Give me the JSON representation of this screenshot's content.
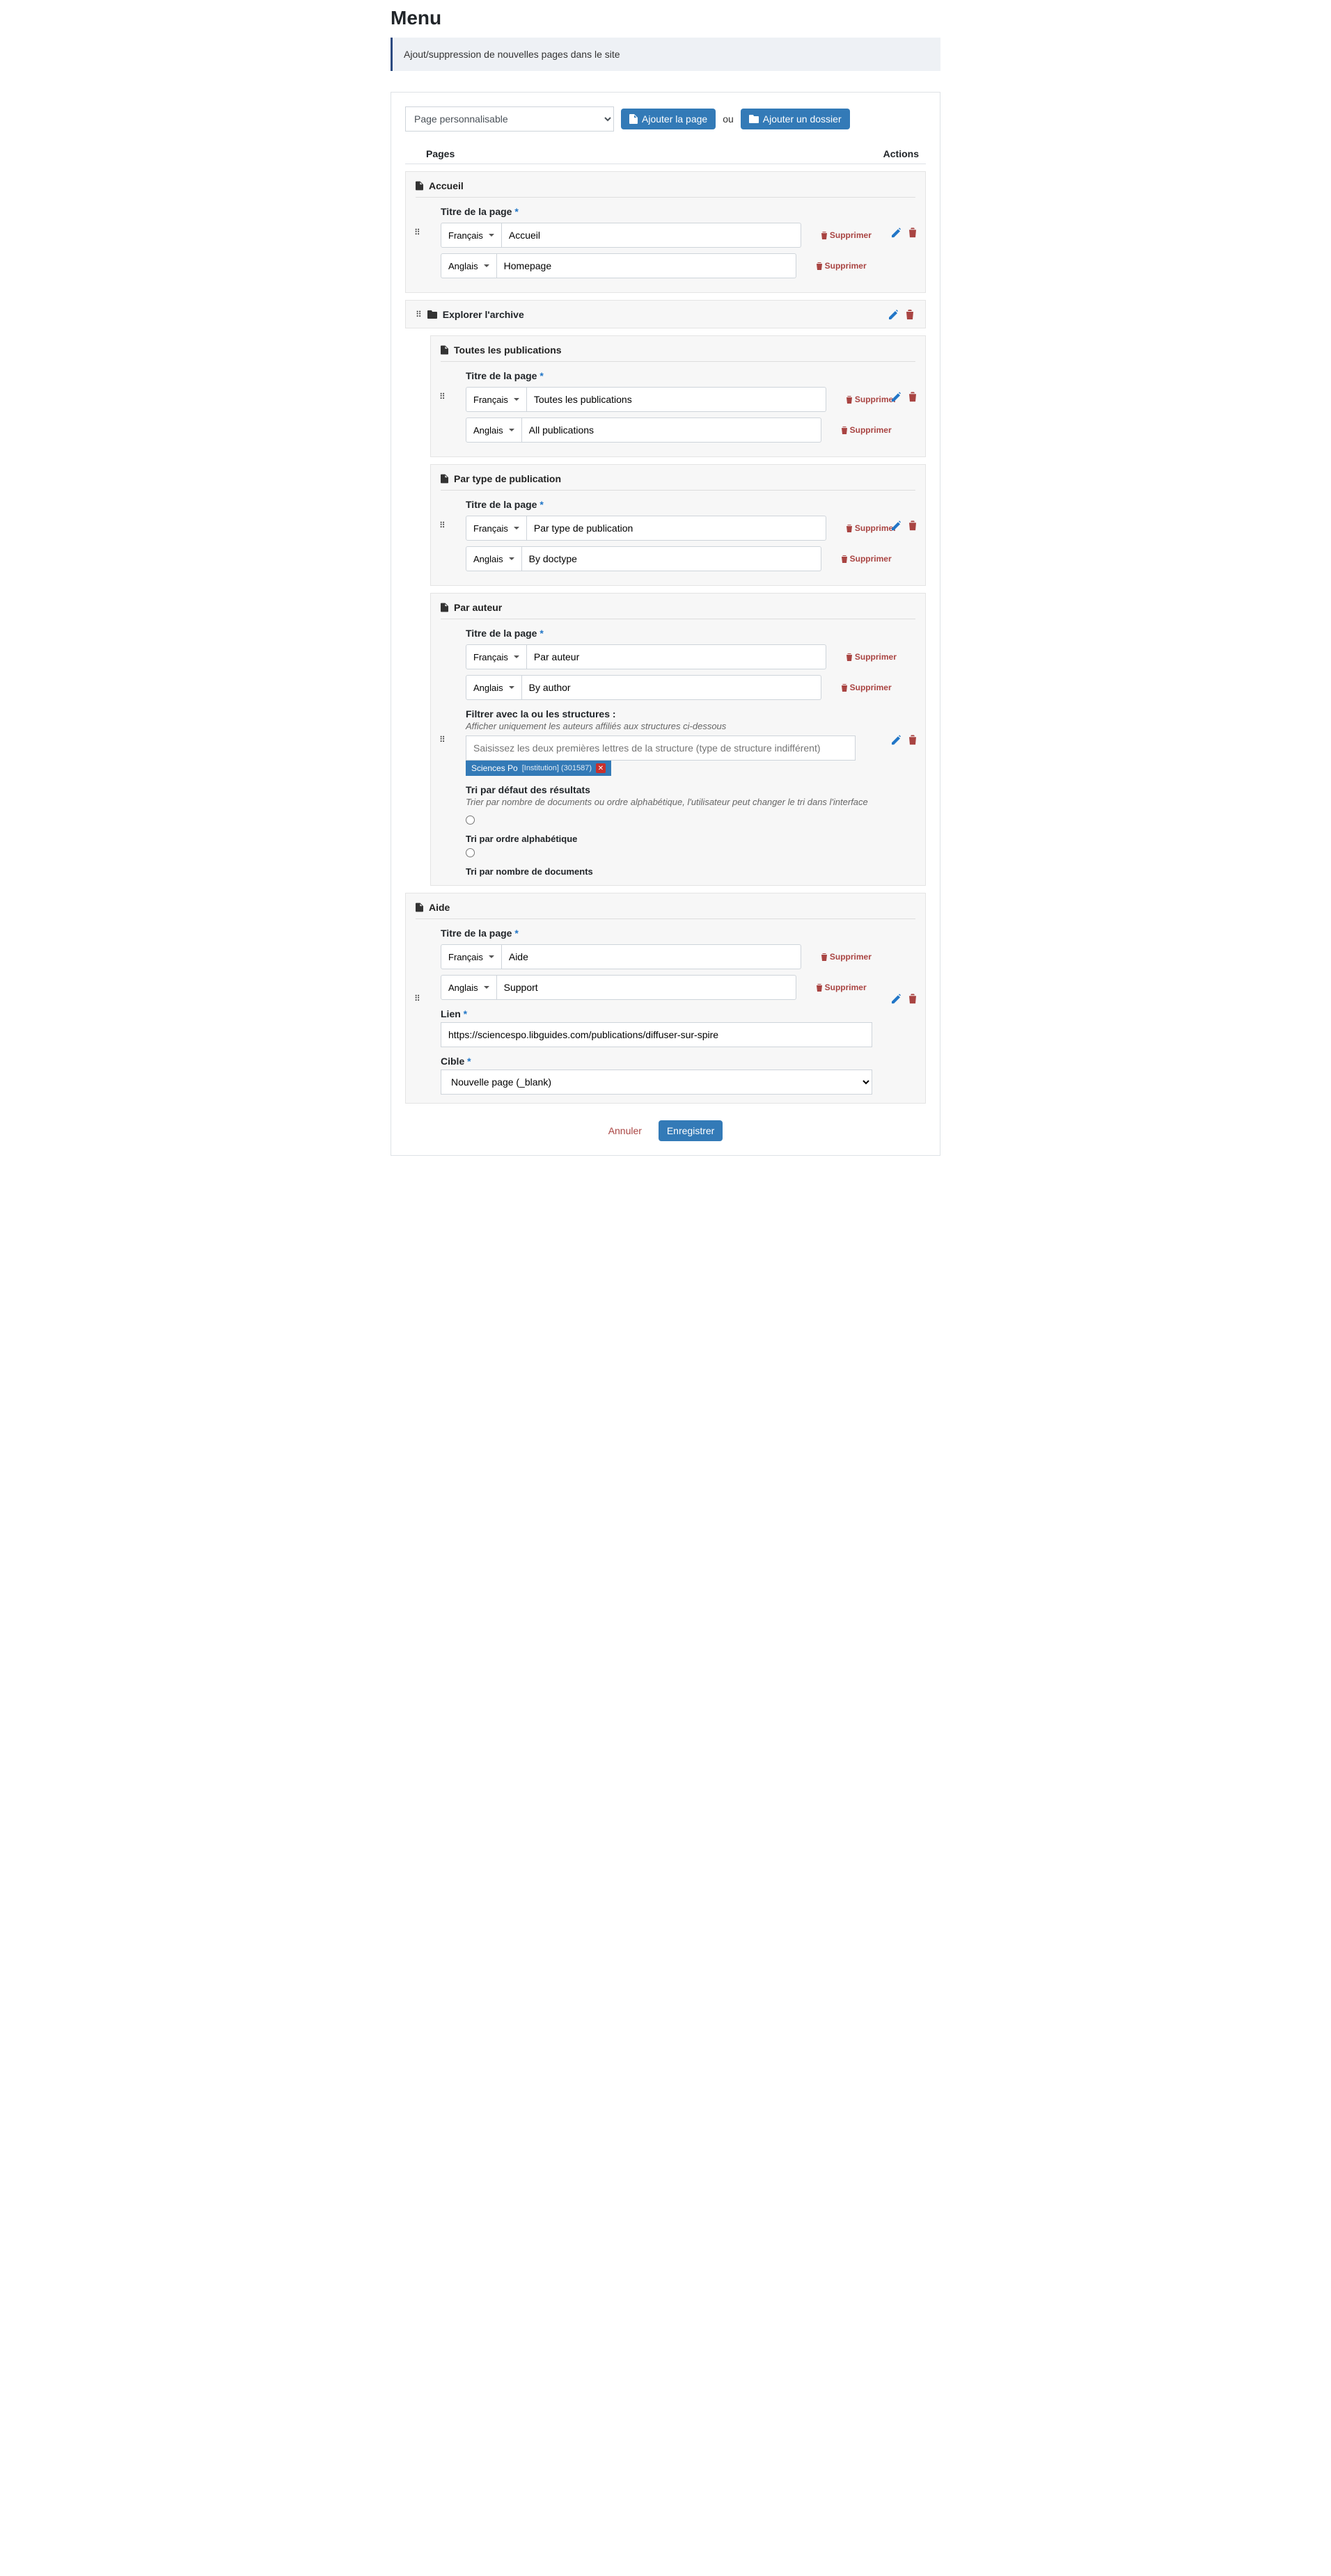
{
  "title": "Menu",
  "banner": "Ajout/suppression de nouvelles pages dans le site",
  "topbar": {
    "page_type_selected": "Page personnalisable",
    "add_page": "Ajouter la page",
    "or": "ou",
    "add_folder": "Ajouter un dossier"
  },
  "headers": {
    "pages": "Pages",
    "actions": "Actions"
  },
  "labels": {
    "title": "Titre de la page",
    "delete": "Supprimer",
    "fr": "Français",
    "en": "Anglais",
    "filter_struct": "Filtrer avec la ou les structures :",
    "filter_hint": "Afficher uniquement les auteurs affiliés aux structures ci-dessous",
    "struct_placeholder": "Saisissez les deux premières lettres de la structure (type de structure indifférent)",
    "chip_name": "Sciences Po",
    "chip_sub": "[Institution] (301587)",
    "sort_default": "Tri par défaut des résultats",
    "sort_hint": "Trier par nombre de documents ou ordre alphabétique, l'utilisateur peut changer le tri dans l'interface",
    "sort_alpha": "Tri par ordre alphabétique",
    "sort_count": "Tri par nombre de documents",
    "link": "Lien",
    "target": "Cible",
    "target_value": "Nouvelle page (_blank)",
    "cancel": "Annuler",
    "save": "Enregistrer"
  },
  "pages": {
    "accueil": {
      "name": "Accueil",
      "fr": "Accueil",
      "en": "Homepage"
    },
    "explorer": {
      "name": "Explorer l'archive"
    },
    "all_pubs": {
      "name": "Toutes les publications",
      "fr": "Toutes les publications",
      "en": "All publications"
    },
    "doctype": {
      "name": "Par type de publication",
      "fr": "Par type de publication",
      "en": "By doctype"
    },
    "auteur": {
      "name": "Par auteur",
      "fr": "Par auteur",
      "en": "By author"
    },
    "aide": {
      "name": "Aide",
      "fr": "Aide",
      "en": "Support",
      "url": "https://sciencespo.libguides.com/publications/diffuser-sur-spire"
    }
  }
}
